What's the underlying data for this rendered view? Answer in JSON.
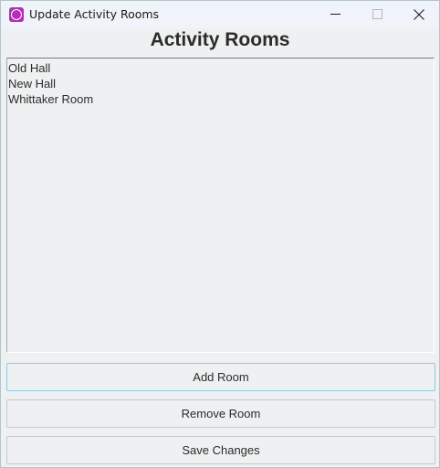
{
  "window": {
    "title": "Update Activity Rooms",
    "app_icon": "app-logo-icon",
    "controls": {
      "minimize_icon": "minimize-icon",
      "maximize_icon": "maximize-icon",
      "close_icon": "close-icon"
    }
  },
  "main": {
    "heading": "Activity Rooms",
    "rooms": [
      "Old Hall",
      "New Hall",
      "Whittaker Room"
    ]
  },
  "buttons": {
    "add_label": "Add Room",
    "remove_label": "Remove Room",
    "save_label": "Save Changes"
  },
  "colors": {
    "app_icon_bg": "#b22fb5",
    "window_bg": "#eff0f1",
    "focus_border": "#8ecbe3"
  }
}
